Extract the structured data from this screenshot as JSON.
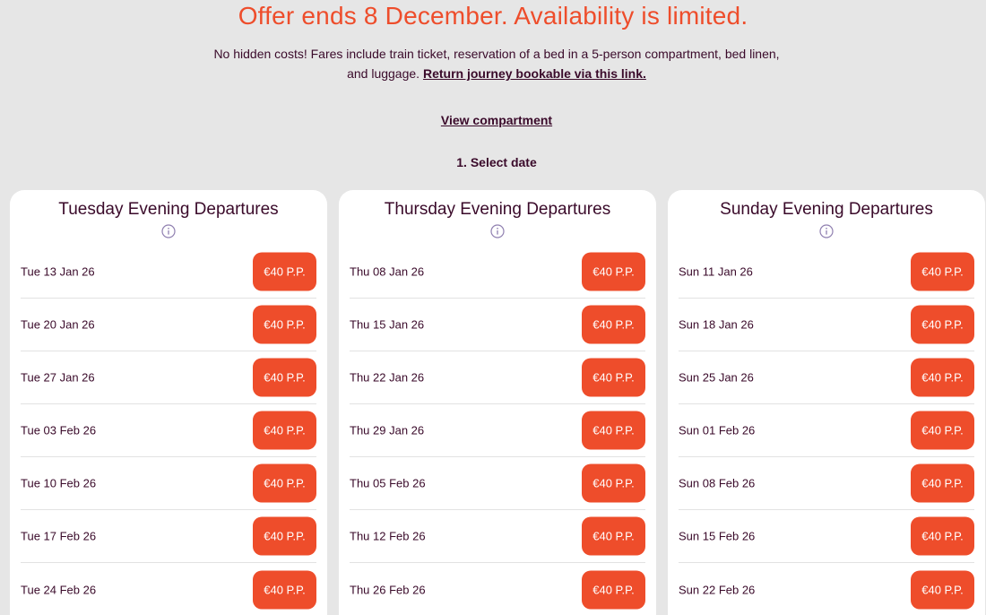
{
  "headline": "Offer ends 8 December. Availability is limited.",
  "description": "No hidden costs! Fares include train ticket, reservation of a bed in a 5-person compartment, bed linen, and luggage.",
  "return_link": "Return journey bookable via this link.",
  "view_compartment_link": "View compartment",
  "step_title": "1. Select date",
  "colors": {
    "accent": "#ee4d2b",
    "text": "#3a0a2a",
    "background": "#e6e6e6",
    "card": "#ffffff",
    "info_icon": "#8f7fb0"
  },
  "columns": [
    {
      "title": "Tuesday Evening Departures",
      "icon": "info-icon",
      "rows": [
        {
          "date": "Tue 13 Jan 26",
          "price": "€40 P.P."
        },
        {
          "date": "Tue 20 Jan 26",
          "price": "€40 P.P."
        },
        {
          "date": "Tue 27 Jan 26",
          "price": "€40 P.P."
        },
        {
          "date": "Tue 03 Feb 26",
          "price": "€40 P.P."
        },
        {
          "date": "Tue 10 Feb 26",
          "price": "€40 P.P."
        },
        {
          "date": "Tue 17 Feb 26",
          "price": "€40 P.P."
        },
        {
          "date": "Tue 24 Feb 26",
          "price": "€40 P.P."
        }
      ]
    },
    {
      "title": "Thursday Evening Departures",
      "icon": "info-icon",
      "rows": [
        {
          "date": "Thu 08 Jan 26",
          "price": "€40 P.P."
        },
        {
          "date": "Thu 15 Jan 26",
          "price": "€40 P.P."
        },
        {
          "date": "Thu 22 Jan 26",
          "price": "€40 P.P."
        },
        {
          "date": "Thu 29 Jan 26",
          "price": "€40 P.P."
        },
        {
          "date": "Thu 05 Feb 26",
          "price": "€40 P.P."
        },
        {
          "date": "Thu 12 Feb 26",
          "price": "€40 P.P."
        },
        {
          "date": "Thu 26 Feb 26",
          "price": "€40 P.P."
        }
      ]
    },
    {
      "title": "Sunday Evening Departures",
      "icon": "info-icon",
      "rows": [
        {
          "date": "Sun 11 Jan 26",
          "price": "€40 P.P."
        },
        {
          "date": "Sun 18 Jan 26",
          "price": "€40 P.P."
        },
        {
          "date": "Sun 25 Jan 26",
          "price": "€40 P.P."
        },
        {
          "date": "Sun 01 Feb 26",
          "price": "€40 P.P."
        },
        {
          "date": "Sun 08 Feb 26",
          "price": "€40 P.P."
        },
        {
          "date": "Sun 15 Feb 26",
          "price": "€40 P.P."
        },
        {
          "date": "Sun 22 Feb 26",
          "price": "€40 P.P."
        }
      ]
    }
  ]
}
